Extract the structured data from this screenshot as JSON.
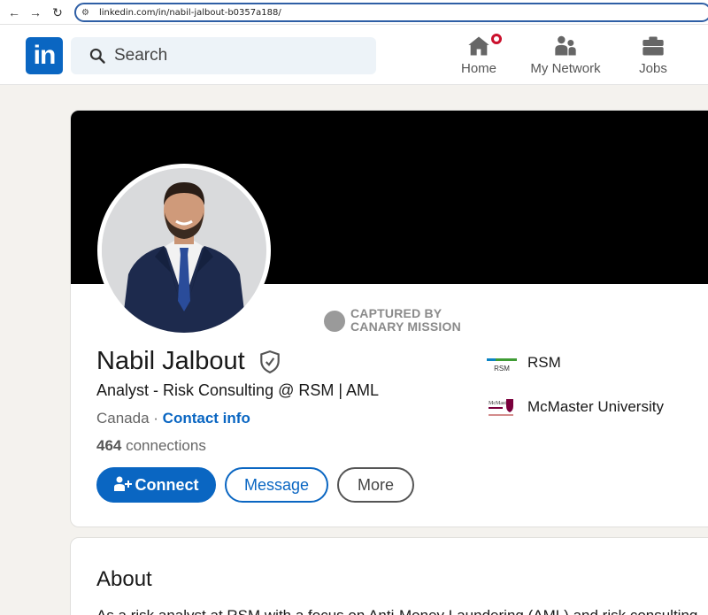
{
  "browser": {
    "url": "linkedin.com/in/nabil-jalbout-b0357a188/",
    "back_glyph": "←",
    "forward_glyph": "→",
    "reload_glyph": "↻",
    "site_info_glyph": "⚙"
  },
  "header": {
    "logo_text": "in",
    "search_placeholder": "Search",
    "nav": [
      {
        "label": "Home",
        "icon": "home-icon"
      },
      {
        "label": "My Network",
        "icon": "people-icon"
      },
      {
        "label": "Jobs",
        "icon": "briefcase-icon"
      }
    ],
    "colors": {
      "brand": "#0a66c2",
      "notification": "#cb112d"
    }
  },
  "profile": {
    "name": "Nabil Jalbout",
    "headline": "Analyst - Risk Consulting @ RSM | AML",
    "location": "Canada",
    "separator": " · ",
    "contact_label": "Contact info",
    "connections_count": "464",
    "connections_label": " connections",
    "watermark_line1": "CAPTURED BY",
    "watermark_line2": "CANARY MISSION",
    "buttons": {
      "connect": "Connect",
      "message": "Message",
      "more": "More"
    },
    "orgs": [
      {
        "name": "RSM",
        "logo_text": "RSM",
        "icon": "rsm-logo"
      },
      {
        "name": "McMaster University",
        "logo_text": "McMaster",
        "icon": "mcmaster-logo"
      }
    ]
  },
  "about": {
    "title": "About",
    "text": "As a risk analyst at RSM with a focus on Anti-Money Laundering (AML) and risk consulting"
  }
}
